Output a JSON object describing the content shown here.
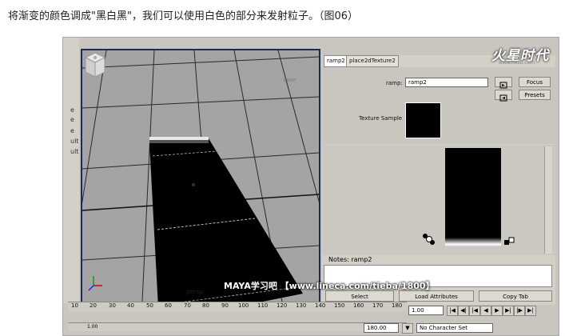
{
  "caption": "将渐变的颜色调成\"黑白黑\"，我们可以使用白色的部分来发射粒子。（图06）",
  "left_strip": [
    "e",
    "e",
    "e",
    "ult",
    "ult"
  ],
  "viewport": {
    "camera_label": "persp",
    "view_cube_label": "RIGHT"
  },
  "panel": {
    "tabs": [
      "ramp2",
      "place2dTexture2"
    ],
    "logo": "火星时代",
    "logo_url": "www.hxsd.com",
    "ramp_label": "ramp:",
    "ramp_value": "ramp2",
    "focus_label": "Focus",
    "presets_label": "Presets",
    "texture_sample_label": "Texture Sample",
    "notes_label": "Notes:  ramp2",
    "buttons": [
      "Select",
      "Load Attributes",
      "Copy Tab"
    ]
  },
  "timeline": {
    "ticks": [
      "10",
      "20",
      "30",
      "40",
      "50",
      "60",
      "70",
      "80",
      "90",
      "100",
      "110",
      "120",
      "130",
      "140",
      "150",
      "160",
      "170",
      "180"
    ],
    "current_frame": "1.00",
    "range_start": "1.00",
    "range_end": "180.00",
    "character_set": "No Character Set"
  },
  "watermark": "MAYA学习吧 【www.lineca.com/tieba/1800】"
}
